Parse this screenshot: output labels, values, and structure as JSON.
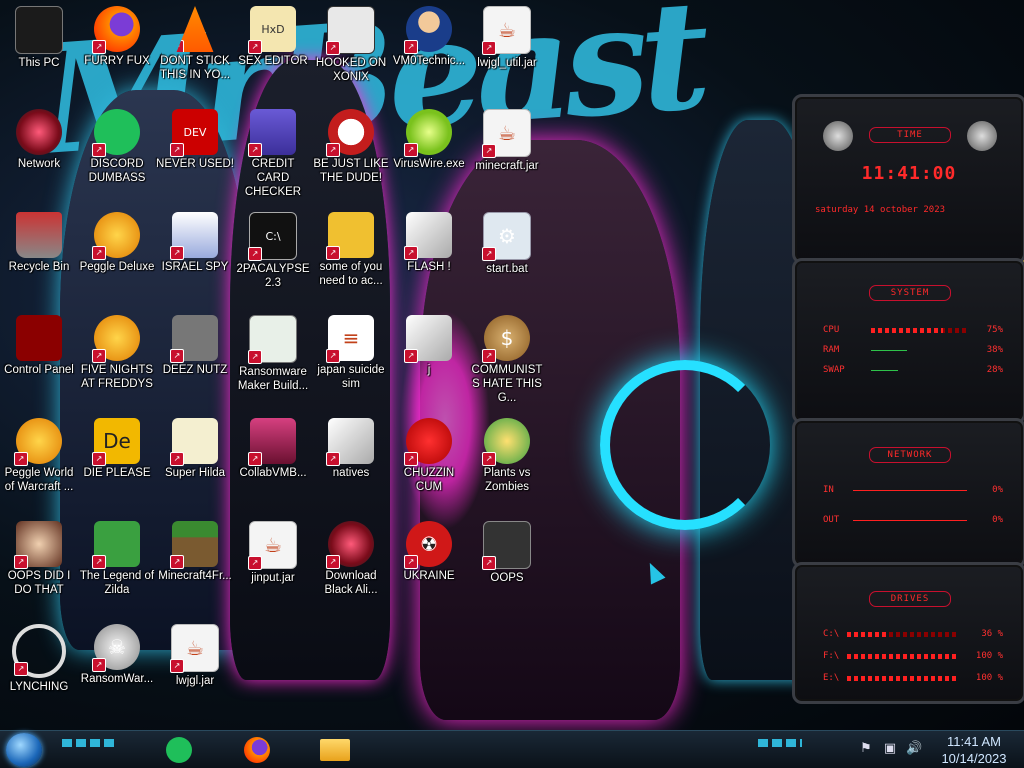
{
  "wallpaper": {
    "title_text": "MrBeast"
  },
  "desktop_icons": [
    {
      "label": "This PC",
      "icon": "computer-icon"
    },
    {
      "label": "FURRY FUX",
      "icon": "firefox-icon"
    },
    {
      "label": "DONT STICK THIS IN YO...",
      "icon": "vlc-cone-icon"
    },
    {
      "label": "SEX EDITOR",
      "icon": "hex-editor-icon"
    },
    {
      "label": "HOOKED ON XONIX",
      "icon": "xonix-game-icon"
    },
    {
      "label": "VM0Technic...",
      "icon": "doctor-icon"
    },
    {
      "label": "lwjgl_util.jar",
      "icon": "java-jar-icon"
    },
    {
      "label": "Network",
      "icon": "network-orb-icon"
    },
    {
      "label": "DISCORD DUMBASS",
      "icon": "chat-app-icon"
    },
    {
      "label": "NEVER USED!",
      "icon": "dev-cpp-icon"
    },
    {
      "label": "CREDIT CARD CHECKER",
      "icon": "credit-card-icon"
    },
    {
      "label": "BE JUST LIKE THE DUDE!",
      "icon": "santa-icon"
    },
    {
      "label": "VirusWire.exe",
      "icon": "lime-icon"
    },
    {
      "label": "minecraft.jar",
      "icon": "java-jar-icon"
    },
    {
      "label": "Recycle Bin",
      "icon": "recycle-bin-icon"
    },
    {
      "label": "Peggle Deluxe",
      "icon": "peggle-icon"
    },
    {
      "label": "ISRAEL SPY",
      "icon": "spy-icon"
    },
    {
      "label": "2PACALYPSE 2.3",
      "icon": "terminal-icon"
    },
    {
      "label": "some of you need to ac...",
      "icon": "dog-icon"
    },
    {
      "label": "FLASH !",
      "icon": "file-icon"
    },
    {
      "label": "start.bat",
      "icon": "batch-gear-icon"
    },
    {
      "label": "Control Panel",
      "icon": "control-panel-icon"
    },
    {
      "label": "FIVE NIGHTS AT FREDDYS",
      "icon": "peggle-icon"
    },
    {
      "label": "DEEZ NUTZ",
      "icon": "window-stack-icon"
    },
    {
      "label": "Ransomware Maker Build...",
      "icon": "app-window-icon"
    },
    {
      "label": "japan suicide sim",
      "icon": "document-icon"
    },
    {
      "label": "j",
      "icon": "file-icon"
    },
    {
      "label": "COMMUNISTS HATE THIS G...",
      "icon": "money-bag-icon"
    },
    {
      "label": "Peggle World of Warcraft ...",
      "icon": "peggle-icon"
    },
    {
      "label": "DIE PLEASE",
      "icon": "de-icon"
    },
    {
      "label": "Super Hilda",
      "icon": "pixel-game-icon"
    },
    {
      "label": "CollabVMB...",
      "icon": "monitor-icon"
    },
    {
      "label": "natives",
      "icon": "file-icon"
    },
    {
      "label": "CHUZZIN CUM",
      "icon": "chuzzle-icon"
    },
    {
      "label": "Plants vs Zombies",
      "icon": "plants-icon"
    },
    {
      "label": "OOPS DID I DO THAT",
      "icon": "portrait-icon"
    },
    {
      "label": "The Legend of Zilda",
      "icon": "zelda-icon"
    },
    {
      "label": "Minecraft4Fr...",
      "icon": "grass-block-icon"
    },
    {
      "label": "jinput.jar",
      "icon": "java-jar-icon"
    },
    {
      "label": "Download Black Ali...",
      "icon": "network-orb-icon"
    },
    {
      "label": "UKRAINE",
      "icon": "radiation-icon"
    },
    {
      "label": "OOPS",
      "icon": "device-icon"
    },
    {
      "label": "LYNCHING",
      "icon": "rope-icon"
    },
    {
      "label": "RansomWar...",
      "icon": "skull-icon"
    },
    {
      "label": "lwjgl.jar",
      "icon": "java-jar-icon"
    }
  ],
  "widgets": {
    "time": {
      "title": "TIME",
      "clock": "11:41:00",
      "date": "saturday 14 october 2023"
    },
    "system": {
      "title": "SYSTEM",
      "rows": [
        {
          "label": "CPU",
          "value": "75%",
          "level": 0.75
        },
        {
          "label": "RAM",
          "value": "38%",
          "level": 0.38
        },
        {
          "label": "SWAP",
          "value": "28%",
          "level": 0.28
        }
      ]
    },
    "network": {
      "title": "NETWORK",
      "rows": [
        {
          "label": "IN",
          "value": "0%"
        },
        {
          "label": "OUT",
          "value": "0%"
        }
      ]
    },
    "drives": {
      "title": "DRIVES",
      "rows": [
        {
          "label": "C:\\",
          "value": "36 %",
          "level": 0.36
        },
        {
          "label": "F:\\",
          "value": "100 %",
          "level": 1.0
        },
        {
          "label": "E:\\",
          "value": "100 %",
          "level": 1.0
        }
      ]
    }
  },
  "taskbar": {
    "start_icon": "start-orb-icon",
    "apps": [
      "chat-app-icon",
      "firefox-icon",
      "file-explorer-icon"
    ],
    "tray": [
      "flag-icon",
      "network-tray-icon",
      "volume-icon"
    ],
    "time": "11:41 AM",
    "date": "10/14/2023"
  },
  "colors": {
    "accent": "#ff2a2a",
    "brush": "#2fb6d9",
    "glow_pink": "#ff2bd6"
  }
}
